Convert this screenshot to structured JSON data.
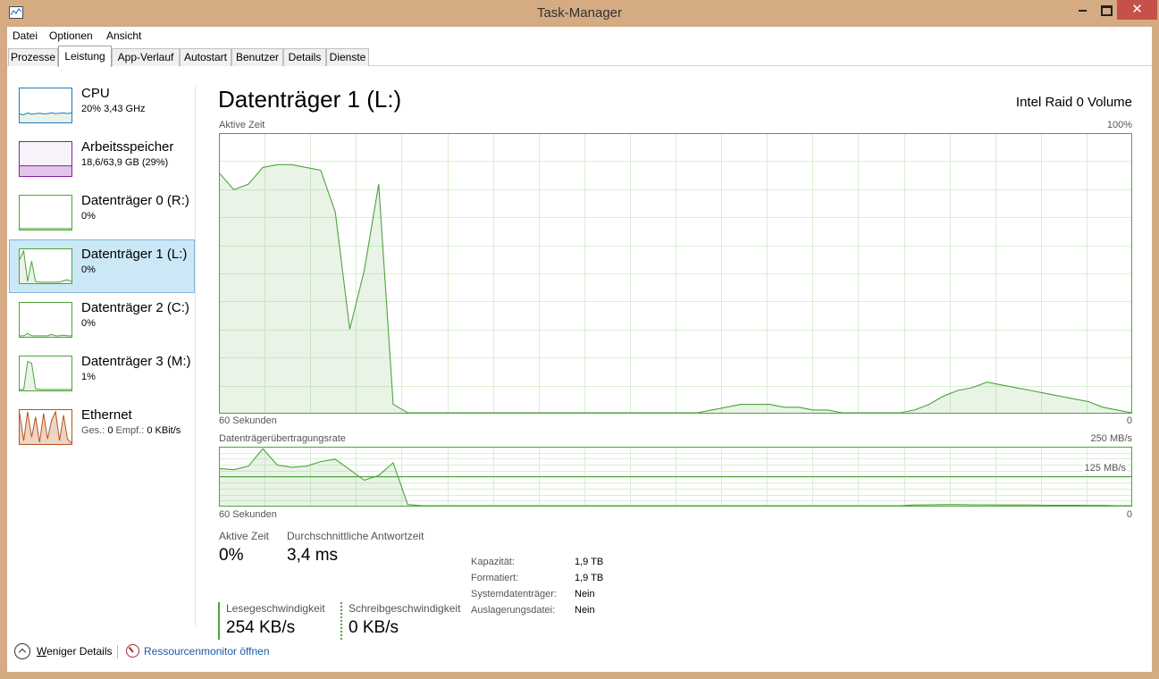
{
  "window": {
    "title": "Task-Manager",
    "close_glyph": "✕"
  },
  "menu": [
    "Datei",
    "Optionen",
    "Ansicht"
  ],
  "tabs": [
    "Prozesse",
    "Leistung",
    "App-Verlauf",
    "Autostart",
    "Benutzer",
    "Details",
    "Dienste"
  ],
  "active_tab": "Leistung",
  "sidebar": {
    "items": [
      {
        "title": "CPU",
        "sub": "20%  3,43 GHz",
        "color": "#1a7bbf",
        "selected": false
      },
      {
        "title": "Arbeitsspeicher",
        "sub": "18,6/63,9 GB (29%)",
        "color": "#8c1aa6",
        "selected": false
      },
      {
        "title": "Datenträger 0 (R:)",
        "sub": "0%",
        "color": "#4da33c",
        "selected": false
      },
      {
        "title": "Datenträger 1 (L:)",
        "sub": "0%",
        "color": "#4da33c",
        "selected": true
      },
      {
        "title": "Datenträger 2 (C:)",
        "sub": "0%",
        "color": "#4da33c",
        "selected": false
      },
      {
        "title": "Datenträger 3 (M:)",
        "sub": "1%",
        "color": "#4da33c",
        "selected": false
      },
      {
        "title": "Ethernet",
        "sub_muted": "Ges.: ",
        "sub_a": "0 ",
        "sub_muted2": "Empf.: ",
        "sub_b": "0 KBit/s",
        "color": "#b5541b",
        "selected": false
      }
    ]
  },
  "main": {
    "title": "Datenträger 1 (L:)",
    "model": "Intel Raid 0 Volume",
    "chart1_label": "Aktive Zeit",
    "chart1_max": "100%",
    "chart1_time": "60 Sekunden",
    "chart1_min": "0",
    "chart2_label": "Datenträgerübertragungsrate",
    "chart2_max": "250 MB/s",
    "chart2_mid": "125 MB/s",
    "chart2_time": "60 Sekunden",
    "chart2_min": "0",
    "stats": {
      "active_label": "Aktive Zeit",
      "active_value": "0%",
      "resp_label": "Durchschnittliche Antwortzeit",
      "resp_value": "3,4 ms",
      "read_label": "Lesegeschwindigkeit",
      "read_value": "254 KB/s",
      "write_label": "Schreibgeschwindigkeit",
      "write_value": "0 KB/s"
    },
    "props": [
      {
        "label": "Kapazität:",
        "value": "1,9 TB"
      },
      {
        "label": "Formatiert:",
        "value": "1,9 TB"
      },
      {
        "label": "Systemdatenträger:",
        "value": "Nein"
      },
      {
        "label": "Auslagerungsdatei:",
        "value": "Nein"
      }
    ]
  },
  "footer": {
    "fewer_first": "W",
    "fewer_rest": "eniger Details",
    "resmon": "Ressourcenmonitor öffnen"
  },
  "chart_data": [
    {
      "type": "area",
      "title": "Aktive Zeit",
      "ylabel": "%",
      "ylim": [
        0,
        100
      ],
      "x_range_seconds": 60,
      "values": [
        86,
        80,
        82,
        88,
        89,
        89,
        88,
        87,
        72,
        30,
        51,
        82,
        3,
        0,
        0,
        0,
        0,
        0,
        0,
        0,
        0,
        0,
        0,
        0,
        0,
        0,
        0,
        0,
        0,
        0,
        0,
        0,
        0,
        0,
        1,
        2,
        3,
        3,
        3,
        2,
        2,
        1,
        1,
        0,
        0,
        0,
        0,
        0,
        1,
        3,
        6,
        8,
        9,
        11,
        10,
        9,
        8,
        7,
        6,
        5,
        4,
        2,
        1,
        0
      ]
    },
    {
      "type": "area",
      "title": "Datenträgerübertragungsrate",
      "ylabel": "MB/s",
      "ylim": [
        0,
        250
      ],
      "reference_line": 125,
      "x_range_seconds": 60,
      "series": [
        {
          "name": "Lesegeschwindigkeit",
          "values": [
            160,
            155,
            170,
            245,
            175,
            165,
            170,
            190,
            200,
            155,
            110,
            130,
            185,
            5,
            0,
            0,
            0,
            0,
            0,
            0,
            0,
            0,
            0,
            0,
            0,
            0,
            0,
            0,
            0,
            0,
            0,
            0,
            0,
            0,
            0,
            0,
            0,
            0,
            0,
            0,
            0,
            0,
            0,
            0,
            0,
            0,
            0,
            0,
            3,
            4,
            5,
            5,
            4,
            4,
            3,
            3,
            3,
            2,
            2,
            2,
            1,
            1,
            0,
            0
          ]
        },
        {
          "name": "Schreibgeschwindigkeit",
          "values": [
            0,
            0,
            0,
            0,
            0,
            0,
            0,
            0,
            0,
            0,
            0,
            0,
            0,
            0,
            0,
            0,
            0,
            0,
            0,
            0,
            0,
            0,
            0,
            0,
            0,
            0,
            0,
            0,
            0,
            0,
            0,
            0,
            0,
            0,
            0,
            0,
            0,
            0,
            0,
            0,
            0,
            0,
            0,
            0,
            0,
            0,
            0,
            0,
            0,
            0,
            0,
            0,
            0,
            0,
            0,
            0,
            0,
            0,
            0,
            0,
            0,
            0,
            0,
            0
          ]
        }
      ]
    }
  ]
}
